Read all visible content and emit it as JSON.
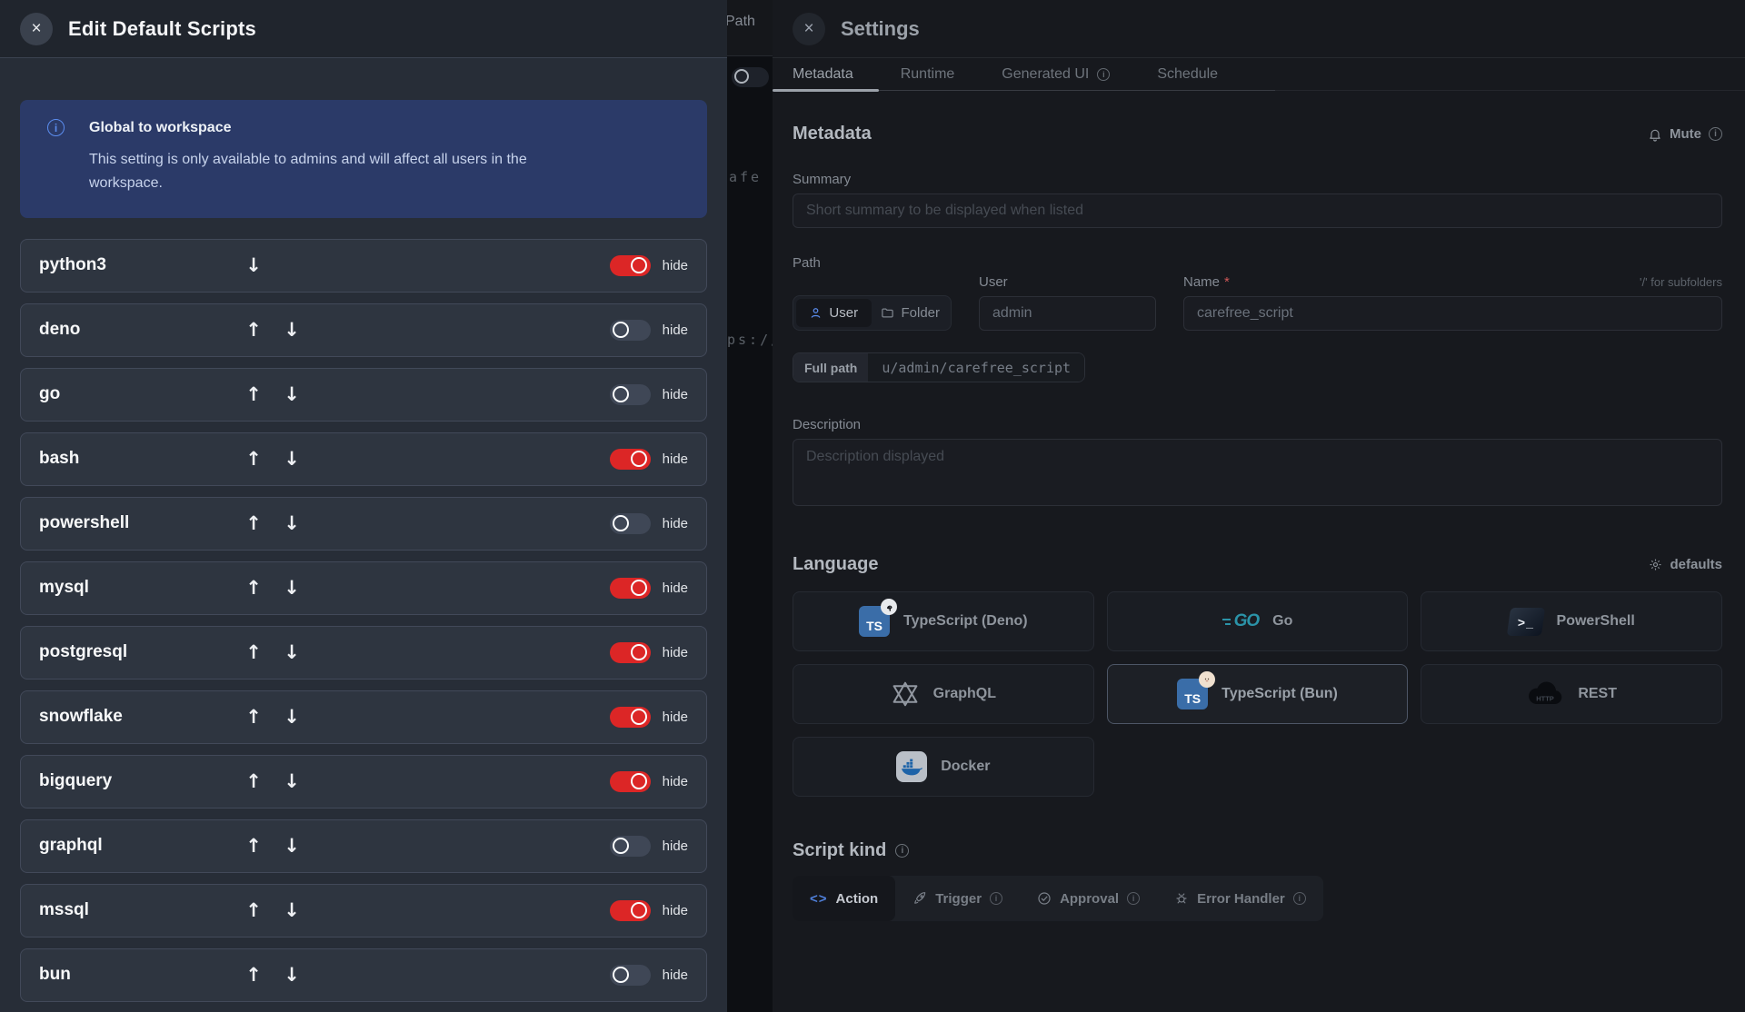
{
  "left_drawer": {
    "title": "Edit Default Scripts",
    "close_glyph": "×",
    "info_box": {
      "title": "Global to workspace",
      "body": "This setting is only available to admins and will affect all users in the workspace."
    },
    "hide_label": "hide",
    "rows": [
      {
        "name": "python3",
        "on": true,
        "up": false,
        "down": true
      },
      {
        "name": "deno",
        "on": false,
        "up": true,
        "down": true
      },
      {
        "name": "go",
        "on": false,
        "up": true,
        "down": true
      },
      {
        "name": "bash",
        "on": true,
        "up": true,
        "down": true
      },
      {
        "name": "powershell",
        "on": false,
        "up": true,
        "down": true
      },
      {
        "name": "mysql",
        "on": true,
        "up": true,
        "down": true
      },
      {
        "name": "postgresql",
        "on": true,
        "up": true,
        "down": true
      },
      {
        "name": "snowflake",
        "on": true,
        "up": true,
        "down": true
      },
      {
        "name": "bigquery",
        "on": true,
        "up": true,
        "down": true
      },
      {
        "name": "graphql",
        "on": false,
        "up": true,
        "down": true
      },
      {
        "name": "mssql",
        "on": true,
        "up": true,
        "down": true
      },
      {
        "name": "bun",
        "on": false,
        "up": true,
        "down": true
      }
    ],
    "up_glyph": "↑",
    "down_glyph": "↓"
  },
  "background_page": {
    "path_label": "Path",
    "code_fragment_1": "afe r",
    "code_fragment_2": "ps://"
  },
  "settings_drawer": {
    "title": "Settings",
    "close_glyph": "×",
    "tabs": [
      {
        "label": "Metadata",
        "active": true,
        "info": false
      },
      {
        "label": "Runtime",
        "active": false,
        "info": false
      },
      {
        "label": "Generated UI",
        "active": false,
        "info": true
      },
      {
        "label": "Schedule",
        "active": false,
        "info": false
      }
    ],
    "mute_label": "Mute",
    "metadata": {
      "heading": "Metadata",
      "summary_label": "Summary",
      "summary_placeholder": "Short summary to be displayed when listed",
      "path_label": "Path",
      "owner_toggle": {
        "user": "User",
        "folder": "Folder"
      },
      "user_label": "User",
      "user_value": "admin",
      "name_label": "Name",
      "required_mark": "*",
      "subfolder_hint": "'/' for subfolders",
      "name_value": "carefree_script",
      "full_path_label": "Full path",
      "full_path_value": "u/admin/carefree_script",
      "description_label": "Description",
      "description_placeholder": "Description displayed"
    },
    "language": {
      "heading": "Language",
      "defaults_label": "defaults",
      "ts_icon_text": "TS",
      "go_icon_text": "GO",
      "ps_icon_text": ">_",
      "rest_icon_text": "HTTP",
      "options": [
        {
          "label": "TypeScript (Deno)",
          "icon": "ts-deno",
          "selected": false
        },
        {
          "label": "Go",
          "icon": "go",
          "selected": false
        },
        {
          "label": "PowerShell",
          "icon": "ps",
          "selected": false
        },
        {
          "label": "GraphQL",
          "icon": "graphql",
          "selected": false
        },
        {
          "label": "TypeScript (Bun)",
          "icon": "ts-bun",
          "selected": true
        },
        {
          "label": "REST",
          "icon": "rest",
          "selected": false
        },
        {
          "label": "Docker",
          "icon": "docker",
          "selected": false
        }
      ]
    },
    "script_kind": {
      "heading": "Script kind",
      "options": [
        {
          "label": "Action",
          "icon": "action",
          "active": true,
          "info": false
        },
        {
          "label": "Trigger",
          "icon": "trigger",
          "active": false,
          "info": true
        },
        {
          "label": "Approval",
          "icon": "approval",
          "active": false,
          "info": true
        },
        {
          "label": "Error Handler",
          "icon": "bug",
          "active": false,
          "info": true
        }
      ]
    }
  },
  "colors": {
    "toggle_on": "#dc2626",
    "toggle_off": "#3f4756",
    "info_box_bg": "#2b3a68",
    "accent_blue": "#5b8def"
  }
}
